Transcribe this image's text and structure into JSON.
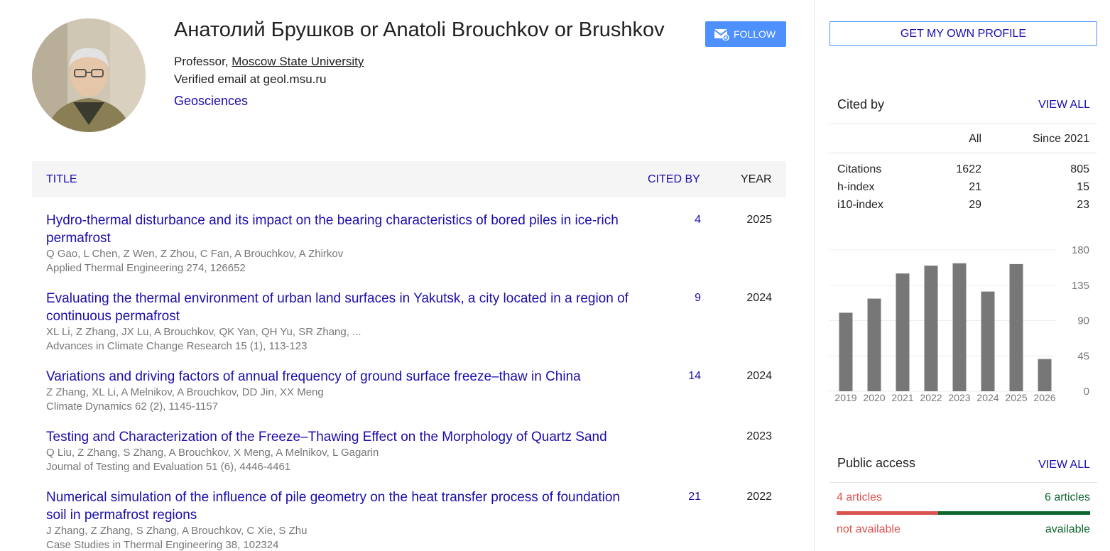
{
  "profile": {
    "name": "Анатолий Брушков or Anatoli Brouchkov or Brushkov",
    "affiliation_prefix": "Professor, ",
    "affiliation_link": "Moscow State University",
    "email": "Verified email at geol.msu.ru",
    "interest": "Geosciences",
    "follow_label": "FOLLOW"
  },
  "table": {
    "headers": {
      "title": "TITLE",
      "cited_by": "CITED BY",
      "year": "YEAR"
    },
    "rows": [
      {
        "title": "Hydro-thermal disturbance and its impact on the bearing characteristics of bored piles in ice-rich permafrost",
        "authors": "Q Gao, L Chen, Z Wen, Z Zhou, C Fan, A Brouchkov, A Zhirkov",
        "venue": "Applied Thermal Engineering 274, 126652",
        "cited": "4",
        "year": "2025"
      },
      {
        "title": "Evaluating the thermal environment of urban land surfaces in Yakutsk, a city located in a region of continuous permafrost",
        "authors": "XL Li, Z Zhang, JX Lu, A Brouchkov, QK Yan, QH Yu, SR Zhang, ...",
        "venue": "Advances in Climate Change Research 15 (1), 113-123",
        "cited": "9",
        "year": "2024"
      },
      {
        "title": "Variations and driving factors of annual frequency of ground surface freeze–thaw in China",
        "authors": "Z Zhang, XL Li, A Melnikov, A Brouchkov, DD Jin, XX Meng",
        "venue": "Climate Dynamics 62 (2), 1145-1157",
        "cited": "14",
        "year": "2024"
      },
      {
        "title": "Testing and Characterization of the Freeze–Thawing Effect on the Morphology of Quartz Sand",
        "authors": "Q Liu, Z Zhang, S Zhang, A Brouchkov, X Meng, A Melnikov, L Gagarin",
        "venue": "Journal of Testing and Evaluation 51 (6), 4446-4461",
        "cited": "",
        "year": "2023"
      },
      {
        "title": "Numerical simulation of the influence of pile geometry on the heat transfer process of foundation soil in permafrost regions",
        "authors": "J Zhang, Z Zhang, S Zhang, A Brouchkov, C Xie, S Zhu",
        "venue": "Case Studies in Thermal Engineering 38, 102324",
        "cited": "21",
        "year": "2022"
      }
    ]
  },
  "sidebar": {
    "get_profile_label": "GET MY OWN PROFILE",
    "cited_by": {
      "title": "Cited by",
      "view_all": "VIEW ALL",
      "col_all": "All",
      "col_since": "Since 2021",
      "rows": [
        {
          "label": "Citations",
          "all": "1622",
          "since": "805"
        },
        {
          "label": "h-index",
          "all": "21",
          "since": "15"
        },
        {
          "label": "i10-index",
          "all": "29",
          "since": "23"
        }
      ]
    },
    "public_access": {
      "title": "Public access",
      "view_all": "VIEW ALL",
      "not_available_count": "4 articles",
      "available_count": "6 articles",
      "not_available_label": "not available",
      "available_label": "available",
      "not_available_fraction": 0.4,
      "red_color": "#d9534f",
      "green_color": "#0d652d"
    }
  },
  "chart_data": {
    "type": "bar",
    "categories": [
      "2019",
      "2020",
      "2021",
      "2022",
      "2023",
      "2024",
      "2025",
      "2026"
    ],
    "values": [
      100,
      118,
      150,
      160,
      163,
      127,
      162,
      41
    ],
    "yticks": [
      0,
      45,
      90,
      135,
      180
    ],
    "ylim": [
      0,
      180
    ],
    "bar_color": "#777777",
    "title": "",
    "xlabel": "",
    "ylabel": ""
  },
  "colors": {
    "link": "#1a0dab",
    "accent": "#4d90fe"
  }
}
